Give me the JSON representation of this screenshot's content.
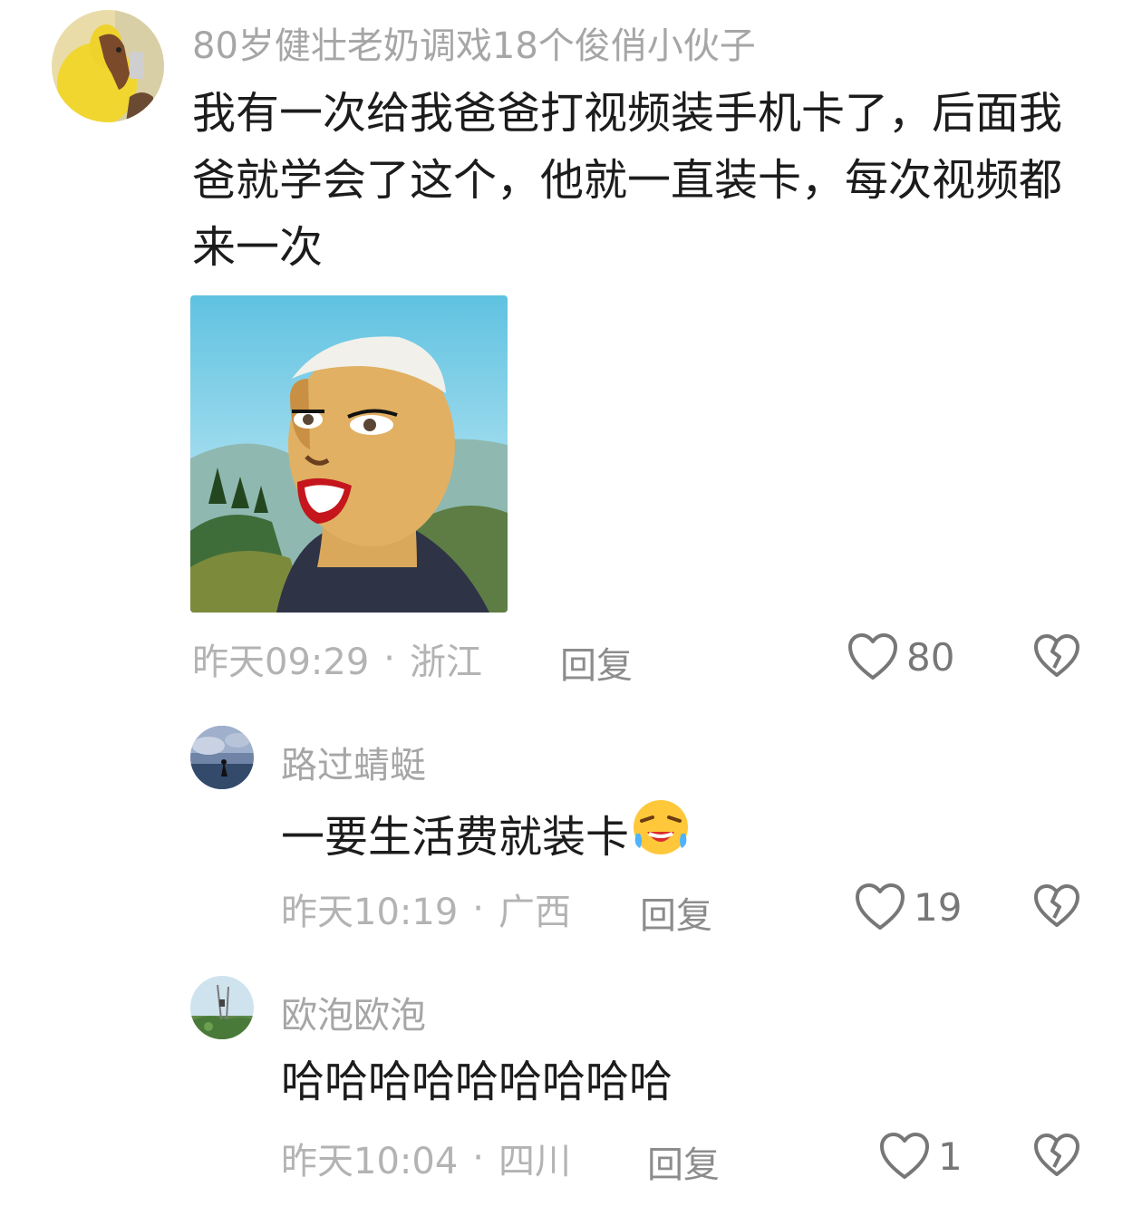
{
  "comments": [
    {
      "username": "80岁健壮老奶调戏18个俊俏小伙子",
      "text": "我有一次给我爸爸打视频装手机卡了，后面我爸就学会了这个，他就一直装卡，每次视频都来一次",
      "time": "昨天09:29",
      "separator": "·",
      "location": "浙江",
      "reply_label": "回复",
      "likes": "80"
    }
  ],
  "replies": [
    {
      "username": "路过蜻蜓",
      "text": "一要生活费就装卡",
      "emoji": "laughing-crying-emoji",
      "time": "昨天10:19",
      "separator": "·",
      "location": "广西",
      "reply_label": "回复",
      "likes": "19"
    },
    {
      "username": "欧泡欧泡",
      "text": "哈哈哈哈哈哈哈哈哈",
      "time": "昨天10:04",
      "separator": "·",
      "location": "四川",
      "reply_label": "回复",
      "likes": "1"
    }
  ],
  "icons": {
    "like": "heart-outline-icon",
    "dislike": "broken-heart-icon"
  },
  "colors": {
    "username": "#a6a6a6",
    "meta": "#b3b3b3",
    "text": "#1c1c1c",
    "icon": "#777777"
  }
}
